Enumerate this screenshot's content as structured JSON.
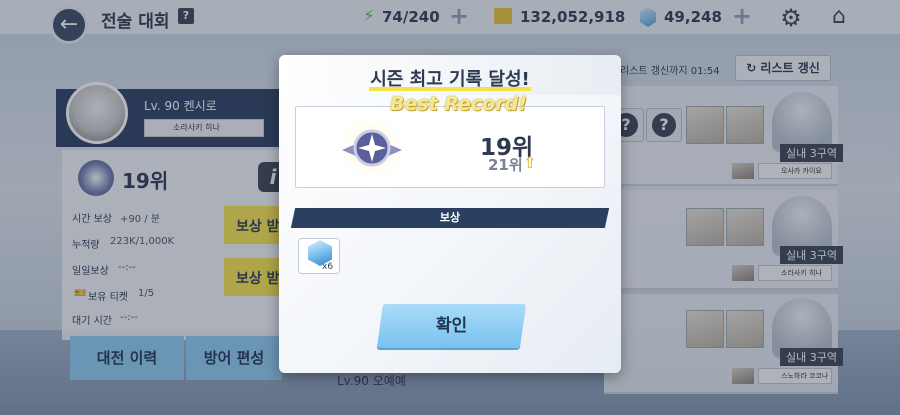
{
  "topbar": {
    "title": "전술 대회",
    "help": "?",
    "stamina": "74/240",
    "credits": "132,052,918",
    "gems": "49,248"
  },
  "profile": {
    "level_name": "Lv. 90  켄시로",
    "name_tag": "소라사키 히나"
  },
  "left_panel": {
    "rank": "19위",
    "time_reward_label": "시간 보상",
    "time_reward_value": "+90 / 분",
    "accumulated_label": "누적량",
    "accumulated_value": "223K/1,000K",
    "daily_reward_label": "일일보상",
    "daily_reward_value": "--:--",
    "tickets_label": "보유 티켓",
    "tickets_value": "1/5",
    "wait_label": "대기 시간",
    "wait_value": "--:--",
    "claim_button_1": "보상 받기",
    "claim_button_2": "보상 받기",
    "battle_log_button": "대전 이력",
    "defense_button": "방어 편성"
  },
  "right_list": {
    "refresh_until": "리스트 갱신까지  01:54",
    "refresh_button": "리스트 갱신",
    "rows": [
      {
        "area": "실내 3구역",
        "tag": "오사카 카이요"
      },
      {
        "area": "실내 3구역",
        "tag": "소라사키 히나"
      },
      {
        "area": "실내 3구역",
        "tag": "스노하라 코코나"
      }
    ],
    "bottom_level": "Lv.90  오예예"
  },
  "modal": {
    "title": "시즌 최고 기록 달성!",
    "best_record": "Best Record!",
    "new_rank": "19위",
    "old_rank": "21위",
    "reward_header": "보상",
    "reward_count": "x6",
    "confirm": "확인"
  },
  "colors": {
    "accent_navy": "#2b3f60",
    "confirm_blue": "#8fcbf0",
    "claim_yellow": "#f7e34d",
    "highlight_yellow": "#f4e24a"
  }
}
